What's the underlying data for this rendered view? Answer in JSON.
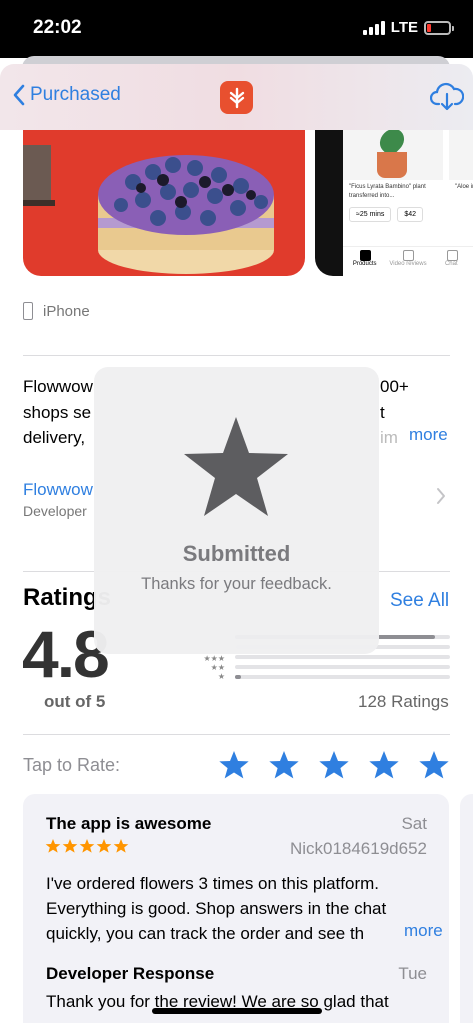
{
  "status_bar": {
    "time": "22:02",
    "network": "LTE"
  },
  "nav": {
    "back_label": "Purchased"
  },
  "screenshots": {
    "plant_caption": "\"Ficus Lyrata Bambino\" plant transferred into...",
    "plant_caption_2": "\"Aloe into b",
    "eta": "≈25 mins",
    "price": "$42",
    "tabs": [
      "Products",
      "Video reviews",
      "Chat"
    ]
  },
  "device": {
    "label": "iPhone"
  },
  "description": {
    "lines": [
      "Flowwow",
      "shops se",
      "delivery, "
    ],
    "lines_right": [
      "00+",
      "t",
      "im"
    ],
    "more": "more"
  },
  "developer": {
    "link": "Flowwow",
    "sub": "Developer"
  },
  "ratings": {
    "title": "Ratings",
    "see_all": "See All",
    "average": "4.8",
    "out_of": "out of 5",
    "count": "128 Ratings",
    "distribution": [
      0.93,
      0,
      0,
      0,
      0.03
    ],
    "star_labels": [
      "★★★",
      "★★",
      "★"
    ]
  },
  "tap_to_rate": {
    "label": "Tap to Rate:",
    "stars": 5,
    "color": "#2f7fe0"
  },
  "review": {
    "title": "The app is awesome",
    "date": "Sat",
    "stars": 5,
    "star_color": "#ff9500",
    "author": "Nick0184619d652",
    "body_lines": [
      "I've ordered flowers 3 times on this platform.",
      "Everything is good. Shop answers in the chat",
      "quickly, you can track the order and see th"
    ],
    "more": "more",
    "dev_response_title": "Developer Response",
    "dev_response_date": "Tue",
    "dev_response_body": "Thank you for the review! We are so glad that"
  },
  "hud": {
    "title": "Submitted",
    "subtitle": "Thanks for your feedback."
  }
}
